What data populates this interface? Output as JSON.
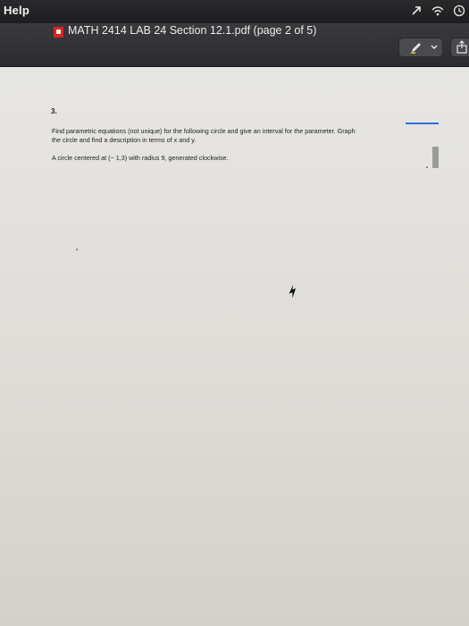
{
  "menubar": {
    "help_label": "Help",
    "icons": [
      "arrow-icon",
      "wifi-icon",
      "clock-icon"
    ]
  },
  "window": {
    "title": "MATH 2414 LAB 24 Section 12.1.pdf (page 2 of 5)",
    "doc_icon": "pdf-document-icon",
    "toolbar": {
      "markup_icon": "pen-icon",
      "markup_menu_icon": "chevron-down-icon",
      "share_icon": "share-icon"
    }
  },
  "document": {
    "question_number": "3.",
    "instruction_line1": "Find parametric equations (not unique) for the following circle and give an interval for the parameter. Graph",
    "instruction_line2": "the circle and find a description in terms of x and y.",
    "problem": "A circle centered at (− 1,3) with radius 9, generated clockwise."
  },
  "colors": {
    "menubar_bg": "#1e1e20",
    "titlebar_bg": "#2c2c2f",
    "page_bg": "#e2e1dd",
    "accent_blue": "#2f6fdc",
    "pdf_red": "#d8261e"
  }
}
